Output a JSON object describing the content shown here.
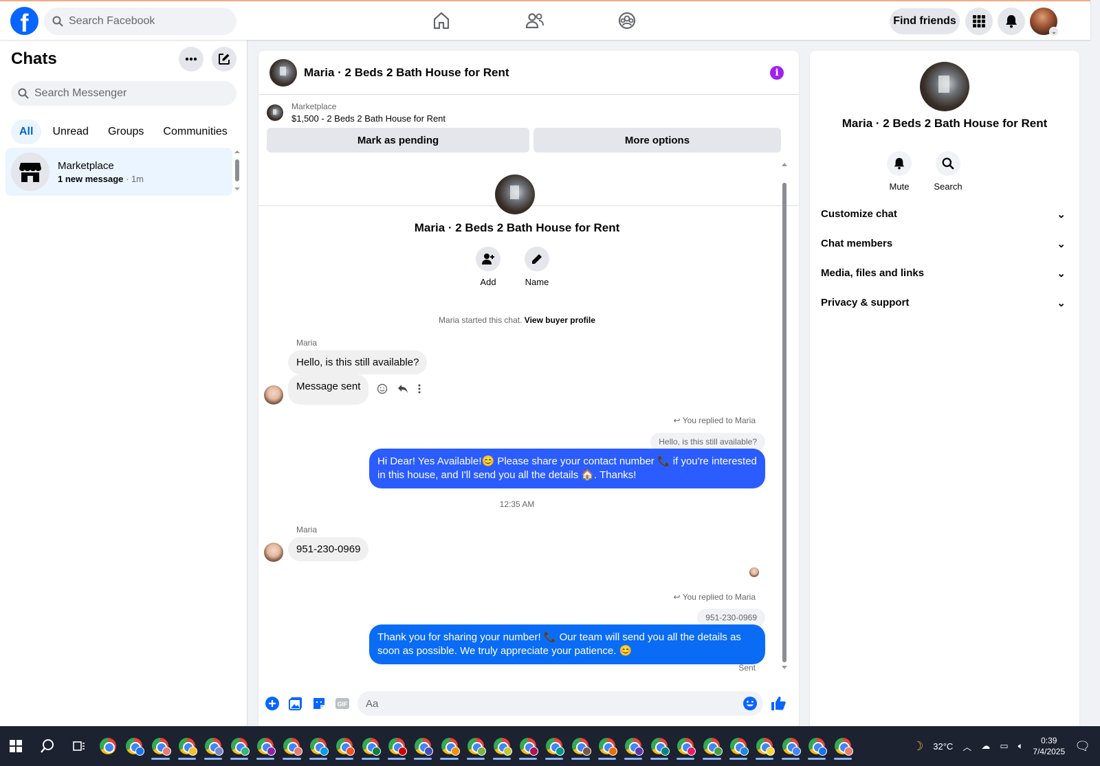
{
  "header": {
    "search_placeholder": "Search Facebook",
    "find_friends": "Find friends"
  },
  "sidebar": {
    "title": "Chats",
    "search_placeholder": "Search Messenger",
    "filters": [
      "All",
      "Unread",
      "Groups",
      "Communities"
    ],
    "chat": {
      "name": "Marketplace",
      "new": "1 new message",
      "time": " · 1m"
    }
  },
  "conversation": {
    "title": "Maria · 2 Beds 2 Bath House for Rent",
    "marketplace_label": "Marketplace",
    "listing": "$1,500 - 2 Beds 2 Bath House for Rent",
    "mark_pending": "Mark as pending",
    "more_options": "More options",
    "add_label": "Add",
    "name_label": "Name",
    "started": "Maria started this chat.",
    "view_profile": "View buyer profile",
    "messages": {
      "sender": "Maria",
      "m1": "Hello, is this still available?",
      "m2": "Message sent",
      "replied": "You replied to Maria",
      "quote1": "Hello, is this still available?",
      "out1": "Hi Dear! Yes Available!😊 Please share your contact number 📞 if you're interested in this house, and I'll send you all the details 🏠. Thanks!",
      "time": "12:35 AM",
      "m3": "951-230-0969",
      "quote2": "951-230-0969",
      "out2": "Thank you for sharing your number! 📞 Our team will send you all the details as soon as possible. We truly appreciate your patience. 😊",
      "status": "Sent"
    },
    "composer_placeholder": "Aa"
  },
  "details": {
    "title": "Maria · 2 Beds 2 Bath House for Rent",
    "mute": "Mute",
    "search": "Search",
    "sections": [
      "Customize chat",
      "Chat members",
      "Media, files and links",
      "Privacy & support"
    ]
  },
  "taskbar": {
    "weather": "32°C",
    "time": "0:39",
    "date": "7/4/2025",
    "icons": [
      "windows-start-icon",
      "search-icon",
      "task-view-icon",
      "chrome-icon"
    ]
  },
  "colors": {
    "brand": "#0866ff",
    "outgoing": "#2b5cff",
    "info": "#a020f0"
  }
}
